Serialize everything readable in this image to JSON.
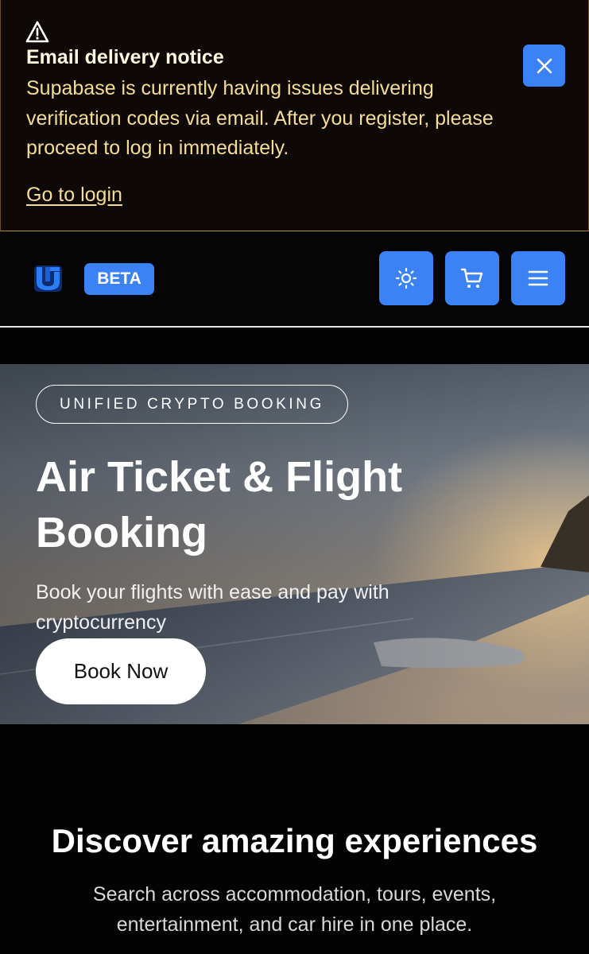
{
  "notice": {
    "icon": "warning-triangle-icon",
    "title": "Email delivery notice",
    "body": "Supabase is currently having issues delivering verification codes via email. After you register, please proceed to log in immediately.",
    "link": "Go to login",
    "colors": {
      "background": "#0e0806",
      "text": "#f6dd95",
      "border": "#b8893f"
    }
  },
  "header": {
    "badge": "BETA",
    "buttons": [
      "sun-icon",
      "cart-icon",
      "menu-icon"
    ],
    "accent": "#3b82f6"
  },
  "hero": {
    "tag": "UNIFIED CRYPTO BOOKING",
    "title": "Air Ticket & Flight Booking",
    "subtitle": "Book your flights with ease and pay with cryptocurrency",
    "cta": "Book Now"
  },
  "discover": {
    "title": "Discover amazing experiences",
    "subtitle": "Search across accommodation, tours, events, entertainment, and car hire in one place."
  }
}
